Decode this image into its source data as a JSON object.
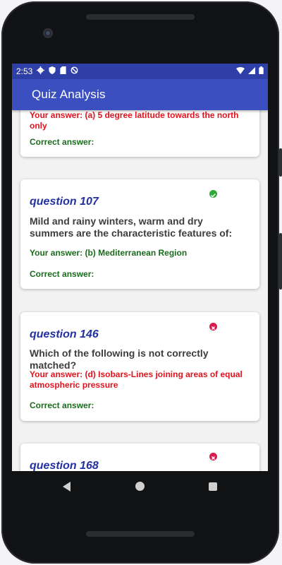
{
  "status_bar": {
    "time": "2:53",
    "icons_left": [
      "gear-icon",
      "shield-icon",
      "sd-card-icon",
      "sync-off-icon"
    ],
    "icons_right": [
      "wifi-icon",
      "signal-icon",
      "battery-icon"
    ]
  },
  "app_bar": {
    "title": "Quiz Analysis"
  },
  "cards": [
    {
      "your_answer": "Your answer: (a) 5 degree latitude towards the north only",
      "correct_label": "Correct answer:"
    },
    {
      "question": "question 107",
      "text": "Mild and rainy winters, warm and dry summers are the characteristic features of:",
      "your_answer": "Your answer: (b) Mediterranean Region",
      "correct_label": "Correct answer:",
      "status": "correct"
    },
    {
      "question": "question 146",
      "text": "Which of the following is not correctly matched?",
      "your_answer": "Your answer: (d) Isobars-Lines joining areas of equal atmospheric pressure",
      "correct_label": "Correct answer:",
      "status": "wrong"
    },
    {
      "question": "question 168",
      "status": "wrong"
    }
  ],
  "colors": {
    "status_bar": "#2f3fa8",
    "app_bar": "#3b4fc0",
    "question_color": "#2332a0",
    "correct_color": "#1b6a1e",
    "wrong_color": "#e0141e",
    "ok_icon": "#2eaa38",
    "error_icon": "#d81b4a"
  },
  "nav_bar": {
    "buttons": [
      "back-button",
      "home-button",
      "recents-button"
    ]
  }
}
